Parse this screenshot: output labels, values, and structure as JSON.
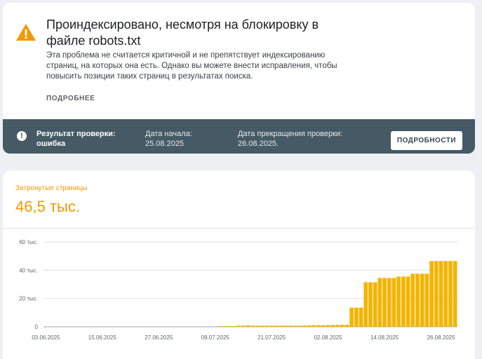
{
  "issue": {
    "title": "Проиндексировано, несмотря на блокировку в файле robots.txt",
    "description": "Эта проблема не считается критичной и не препятствует индексированию страниц, на которых она есть. Однако вы можете внести исправления, чтобы повысить позиции таких страниц в результатах поиска.",
    "more_label": "ПОДРОБНЕЕ",
    "icon": "warning-triangle-icon",
    "icon_color": "#f29900"
  },
  "status": {
    "result": "Результат проверки: ошибка",
    "start": "Дата начала: 25.08.2025",
    "end": "Дата прекращения проверки: 26.08.2025.",
    "button_label": "ПОДРОБНОСТИ",
    "icon": "alert-circle-icon",
    "background": "#455a64"
  },
  "metric": {
    "label": "Затронутые страницы",
    "value": "46,5 тыс.",
    "color": "#f29900"
  },
  "chart_data": {
    "type": "bar",
    "bar_color": "#f4b400",
    "y_ticks": [
      {
        "value": 0,
        "label": "0"
      },
      {
        "value": 20000,
        "label": "20 тыс."
      },
      {
        "value": 40000,
        "label": "40 тыс."
      },
      {
        "value": 60000,
        "label": "60 тыс."
      }
    ],
    "ylim": [
      0,
      60000
    ],
    "x_start": "2025-06-03",
    "x_ticks": [
      "03.06.2025",
      "15.06.2025",
      "27.06.2025",
      "09.07.2025",
      "21.07.2025",
      "02.08.2025",
      "14.08.2025",
      "26.08.2025"
    ],
    "values": [
      0,
      0,
      0,
      0,
      0,
      0,
      0,
      0,
      0,
      0,
      0,
      0,
      0,
      0,
      0,
      0,
      0,
      0,
      0,
      0,
      0,
      0,
      0,
      0,
      0,
      0,
      0,
      0,
      0,
      0,
      0,
      0,
      0,
      0,
      0,
      0,
      0,
      500,
      500,
      500,
      500,
      800,
      800,
      1000,
      800,
      800,
      800,
      800,
      800,
      800,
      800,
      800,
      800,
      800,
      800,
      900,
      1000,
      1100,
      1100,
      1100,
      1200,
      1300,
      1300,
      1400,
      1400,
      13500,
      13500,
      13500,
      31500,
      31500,
      31500,
      34500,
      34500,
      34500,
      34500,
      35500,
      35500,
      35500,
      37500,
      37500,
      37500,
      37500,
      46500,
      46500,
      46500,
      46500,
      46500,
      46500
    ]
  }
}
